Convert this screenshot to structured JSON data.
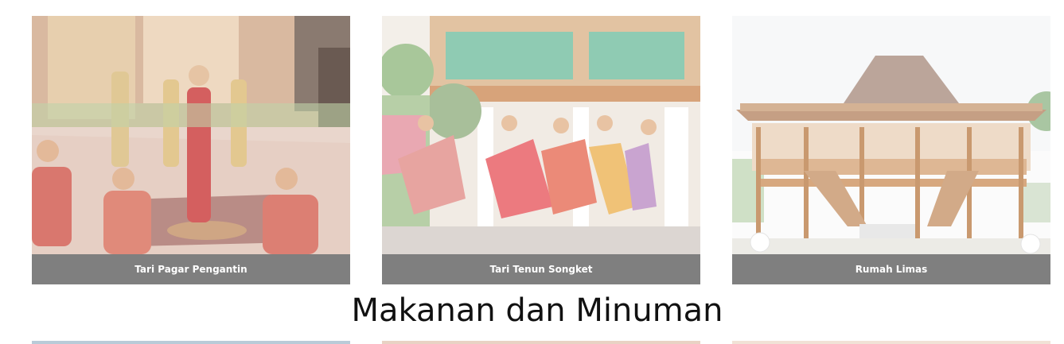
{
  "gallery": {
    "cards": [
      {
        "caption": "Tari Pagar Pengantin",
        "image": "wedding-dance-photo"
      },
      {
        "caption": "Tari Tenun Songket",
        "image": "songket-dance-photo"
      },
      {
        "caption": "Rumah Limas",
        "image": "traditional-house-photo"
      }
    ]
  },
  "section": {
    "title": "Makanan dan Minuman"
  },
  "colors": {
    "caption_bg": "#7f7f7f",
    "caption_text": "#ffffff",
    "title_text": "#111111"
  }
}
